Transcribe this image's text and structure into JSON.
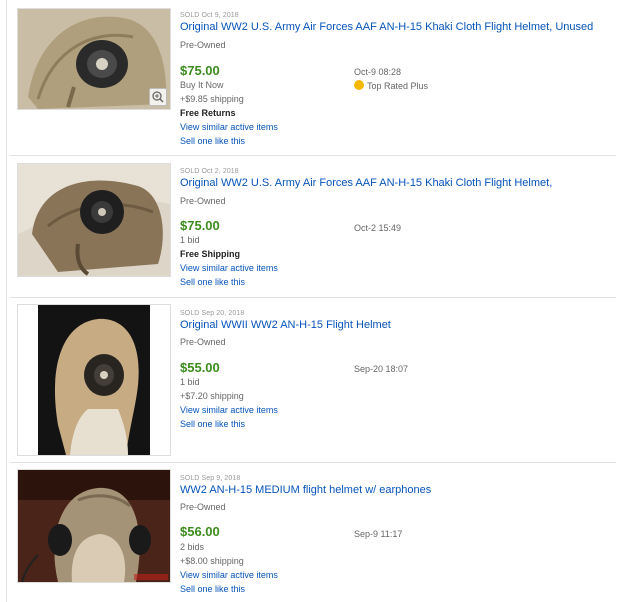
{
  "colors": {
    "link": "#0654ba",
    "price": "#3b8c1d",
    "muted": "#666666",
    "sold": "#999999"
  },
  "items": [
    {
      "sold": "SOLD Oct 9, 2018",
      "title": "Original WW2 U.S. Army Air Forces AAF AN-H-15 Khaki Cloth Flight Helmet, Unused",
      "condition": "Pre-Owned",
      "price": "$75.00",
      "format": "Buy It Now",
      "shipping": "+$9.85 shipping",
      "extra": "Free Returns",
      "similar": "View similar active items",
      "sell": "Sell one like this",
      "time": "Oct-9 08:28",
      "badge": "Top Rated Plus",
      "badge_icon": "top-rated-medal-icon"
    },
    {
      "sold": "SOLD Oct 2, 2018",
      "title": "Original WW2 U.S. Army Air Forces AAF AN-H-15 Khaki Cloth Flight Helmet,",
      "condition": "Pre-Owned",
      "price": "$75.00",
      "format": "1 bid",
      "extra": "Free Shipping",
      "similar": "View similar active items",
      "sell": "Sell one like this",
      "time": "Oct-2 15:49"
    },
    {
      "sold": "SOLD Sep 20, 2018",
      "title": "Original WWII WW2 AN-H-15 Flight Helmet",
      "condition": "Pre-Owned",
      "price": "$55.00",
      "format": "1 bid",
      "shipping": "+$7.20 shipping",
      "similar": "View similar active items",
      "sell": "Sell one like this",
      "time": "Sep-20 18:07"
    },
    {
      "sold": "SOLD Sep 9, 2018",
      "title": "WW2 AN-H-15 MEDIUM flight helmet w/ earphones",
      "condition": "Pre-Owned",
      "price": "$56.00",
      "format": "2 bids",
      "shipping": "+$8.00 shipping",
      "similar": "View similar active items",
      "sell": "Sell one like this",
      "time": "Sep-9 11:17"
    }
  ]
}
